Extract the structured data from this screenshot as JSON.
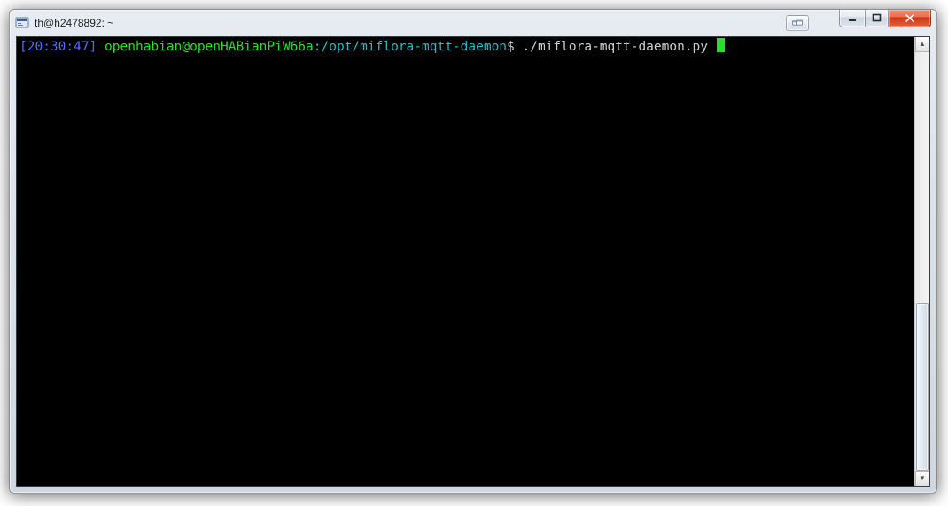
{
  "window": {
    "title": "th@h2478892: ~"
  },
  "terminal": {
    "timestamp": "[20:30:47]",
    "user": "openhabian",
    "at": "@",
    "host": "openHABianPiW66a",
    "colon": ":",
    "path": "/opt/miflora-mqtt-daemon",
    "dollar": "$",
    "command": "./miflora-mqtt-daemon.py"
  },
  "icons": {
    "app": "terminal-icon",
    "extra": "dual-monitor-icon",
    "min": "minimize-icon",
    "max": "maximize-icon",
    "close": "close-icon",
    "sbup": "scroll-up-icon",
    "sbdown": "scroll-down-icon"
  }
}
